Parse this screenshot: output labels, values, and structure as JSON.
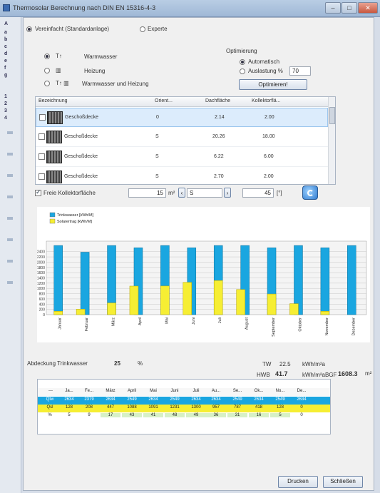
{
  "window": {
    "title": "Thermosolar Berechnung nach DIN EN 15316-4-3",
    "minimize": "–",
    "maximize": "□",
    "close": "✕"
  },
  "sidebar": {
    "letters": [
      "A",
      "a",
      "b",
      "c",
      "d",
      "e",
      "f",
      "g",
      "1",
      "2",
      "3",
      "4"
    ]
  },
  "mode": {
    "simplified_label": "Vereinfacht (Standardanlage)",
    "expert_label": "Experte",
    "selected": "simplified"
  },
  "usage": {
    "options": [
      {
        "prefix": "T↑",
        "label": "Warmwasser",
        "selected": true
      },
      {
        "prefix": "▥",
        "label": "Heizung",
        "selected": false
      },
      {
        "prefix": "T↑ ▥",
        "label": "Warmwasser und Heizung",
        "selected": false
      }
    ]
  },
  "optimization": {
    "group_label": "Optimierung",
    "auto_label": "Automatisch",
    "util_label": "Auslastung %",
    "util_value": "70",
    "selected": "auto",
    "button_label": "Optimieren!"
  },
  "grid": {
    "headers": [
      "Bezeichnung",
      "Orient...",
      "Dachfläche",
      "Kollektorflä..."
    ],
    "rows": [
      {
        "name": "Geschoßdecke",
        "orientation": "0",
        "roof": "2.14",
        "collector": "2.00",
        "selected": true
      },
      {
        "name": "Geschoßdecke",
        "orientation": "S",
        "roof": "20.26",
        "collector": "18.00",
        "selected": false
      },
      {
        "name": "Geschoßdecke",
        "orientation": "S",
        "roof": "6.22",
        "collector": "6.00",
        "selected": false
      },
      {
        "name": "Geschoßdecke",
        "orientation": "S",
        "roof": "2.70",
        "collector": "2.00",
        "selected": false
      }
    ]
  },
  "free_collector": {
    "label": "Freie Kollektorfläche",
    "checked": true,
    "area_value": "15",
    "area_unit": "m²",
    "orientation_value": "S",
    "tilt_value": "45",
    "tilt_unit": "[°]"
  },
  "chart_data": {
    "type": "bar",
    "categories": [
      "Januar",
      "Februar",
      "März",
      "April",
      "Mai",
      "Juni",
      "Juli",
      "August",
      "September",
      "Oktober",
      "November",
      "Dezember"
    ],
    "series": [
      {
        "name": "Trinkwasser [kWh/M]",
        "color": "#1aa6e0",
        "values": [
          2634,
          2379,
          2634,
          2549,
          2634,
          2549,
          2634,
          2634,
          2549,
          2634,
          2549,
          2634
        ]
      },
      {
        "name": "Solarertrag [kWh/M]",
        "color": "#f6ee33",
        "values": [
          128,
          208,
          447,
          1088,
          1091,
          1231,
          1300,
          957,
          787,
          418,
          128,
          0
        ]
      }
    ],
    "yticks": [
      "0",
      "200",
      "400",
      "600",
      "800",
      "1000",
      "1200",
      "1400",
      "1600",
      "1800",
      "2000",
      "2200",
      "2400"
    ],
    "ylim": [
      0,
      2800
    ],
    "grid": true,
    "legend": "top-left"
  },
  "coverage": {
    "label": "Abdeckung Trinkwasser",
    "value": "25",
    "unit": "%"
  },
  "summary": {
    "tw_label": "TW",
    "tw_value": "22.5",
    "tw_unit": "kWh/m²a",
    "hsb_label": "HWB",
    "hsb_value": "41.7",
    "hsb_unit": "kWh/m²a",
    "bgf_label": "BGF",
    "bgf_value": "1608.3",
    "bgf_unit": "m²"
  },
  "monthly_table": {
    "headers": [
      "---",
      "Ja...",
      "Fe...",
      "März",
      "April",
      "Mai",
      "Juni",
      "Juli",
      "Au...",
      "Se...",
      "Ok...",
      "No...",
      "De..."
    ],
    "rows": [
      {
        "label": "Qtw",
        "values": [
          "2634",
          "2379",
          "2634",
          "2549",
          "2634",
          "2549",
          "2634",
          "2634",
          "2549",
          "2634",
          "2549",
          "2634"
        ]
      },
      {
        "label": "Qsl",
        "values": [
          "128",
          "208",
          "447",
          "1088",
          "1091",
          "1231",
          "1300",
          "957",
          "787",
          "418",
          "128",
          "0"
        ]
      },
      {
        "label": "%",
        "values": [
          "5",
          "9",
          "17",
          "43",
          "41",
          "48",
          "49",
          "36",
          "31",
          "16",
          "5",
          "0"
        ]
      }
    ]
  },
  "footer": {
    "print_label": "Drucken",
    "close_label": "Schließen"
  }
}
